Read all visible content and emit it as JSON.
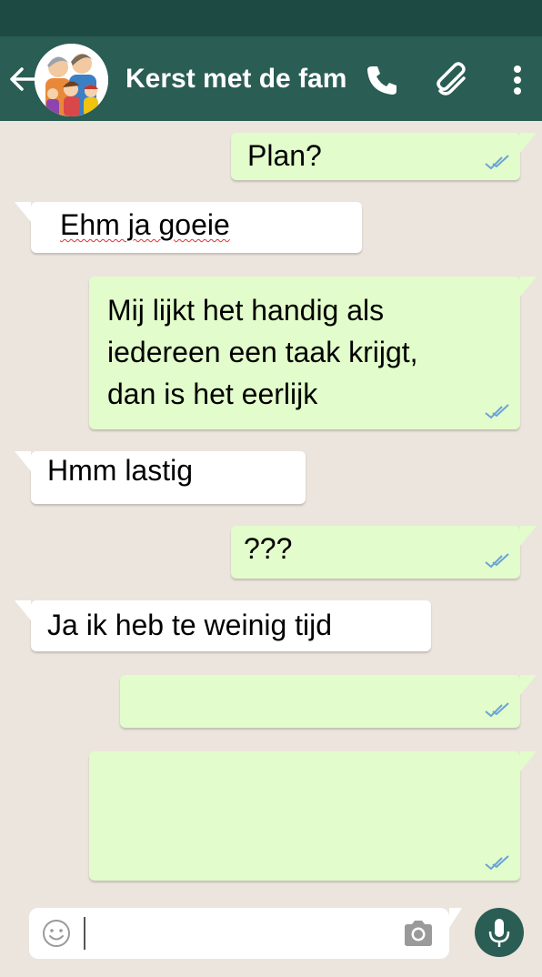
{
  "header": {
    "title": "Kerst met de fam",
    "icons": [
      "back-arrow-icon",
      "group-avatar",
      "phone-icon",
      "paperclip-icon",
      "more-vert-icon"
    ]
  },
  "messages": [
    {
      "direction": "out",
      "text": "Plan?"
    },
    {
      "direction": "in",
      "text": "Ehm ja goeie"
    },
    {
      "direction": "out",
      "lines": [
        "Mij lijkt het handig als",
        "iedereen een taak krijgt,",
        "dan is het eerlijk"
      ]
    },
    {
      "direction": "in",
      "text": "Hmm lastig"
    },
    {
      "direction": "out",
      "text": "???"
    },
    {
      "direction": "in",
      "text": "Ja ik heb te weinig tijd"
    },
    {
      "direction": "out",
      "text": ""
    },
    {
      "direction": "out",
      "text": ""
    }
  ],
  "composer": {
    "placeholder": ""
  },
  "colors": {
    "header": "#2a5d54",
    "statusbar": "#1d4a42",
    "background": "#ece5dd",
    "outgoing_bubble": "#e2fccb",
    "incoming_bubble": "#ffffff",
    "tick": "#6aa3d6"
  }
}
